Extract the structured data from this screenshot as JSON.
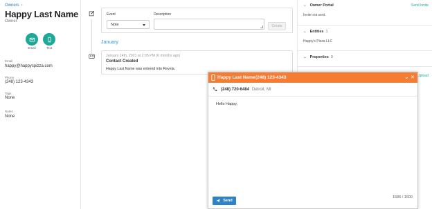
{
  "breadcrumb": {
    "parent": "Owners",
    "separator": "›"
  },
  "contact": {
    "name": "Happy Last Name",
    "role": "Owner",
    "actions": [
      {
        "label": "Email",
        "icon": "mail-icon"
      },
      {
        "label": "Text",
        "icon": "phone-icon"
      }
    ],
    "fields": [
      {
        "label": "Email",
        "value": "happy@happyspizza.com"
      },
      {
        "label": "Phone",
        "value": "(248) 123-4343"
      },
      {
        "label": "Tags",
        "value": "None"
      },
      {
        "label": "Notes",
        "value": "None"
      }
    ]
  },
  "new_activity": {
    "event_label": "Event",
    "event_value": "Note",
    "description_label": "Description",
    "create_label": "Create"
  },
  "timeline": {
    "month": "January",
    "event": {
      "date": "January 14th, 2021 at 2:05 PM (6 months ago)",
      "title": "Contact Created",
      "body": "Happy Last Name was entered into Revela."
    }
  },
  "right_panel": {
    "owner_portal": {
      "title": "Owner Portal",
      "link": "Send Invite",
      "status": "Invite not sent."
    },
    "entities": {
      "title": "Entities",
      "count": "1",
      "item": "Happy's Pizza LLC"
    },
    "properties": {
      "title": "Properties",
      "count": "0"
    },
    "partial_link": "Upload"
  },
  "sms_popup": {
    "title_name": "Happy Last Name",
    "title_phone": "(248) 123-4343",
    "to_number": "(248) 720-6484",
    "to_location": "Detroit, MI",
    "message": "Hello Happy,",
    "char_counter": "1586 / 1600",
    "send_label": "Send",
    "minimize": "⌄",
    "close": "✕"
  },
  "colors": {
    "accent_teal": "#1ea898",
    "popup_header": "#f57c32",
    "send_button": "#2e83c6",
    "month_link": "#2b9bd1"
  }
}
